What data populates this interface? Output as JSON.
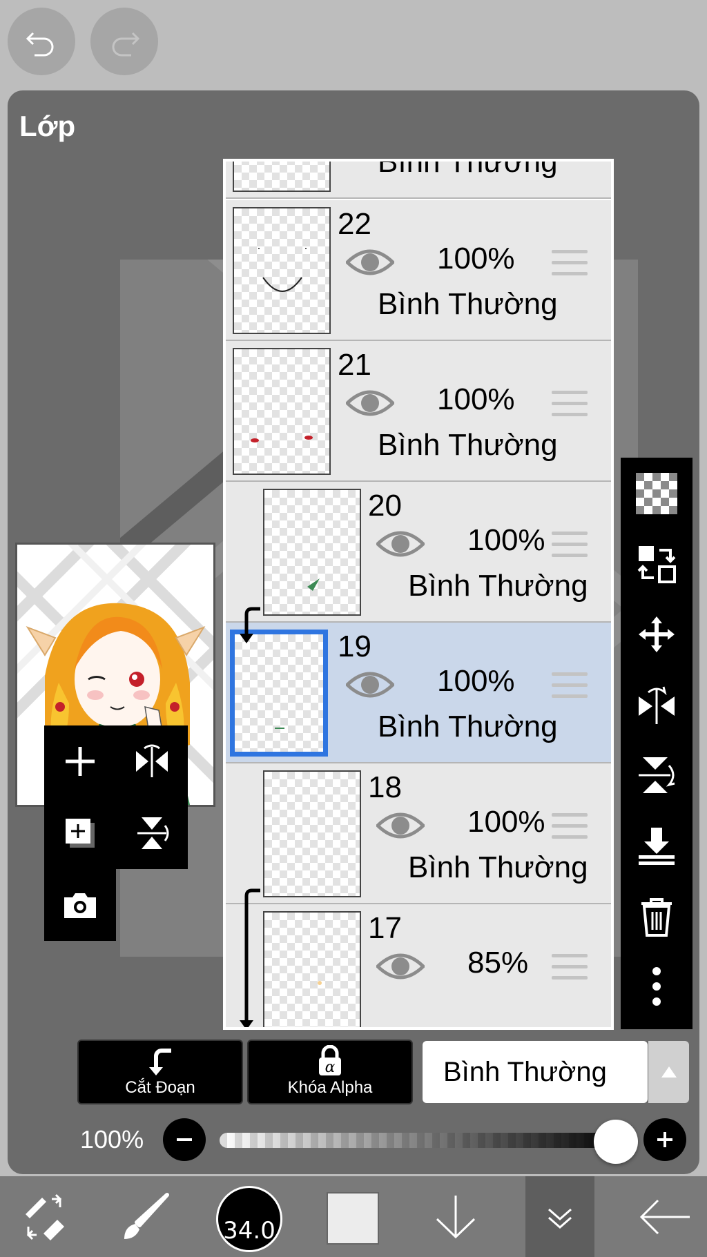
{
  "top_buttons": {
    "undo_icon": "undo-icon",
    "redo_icon": "redo-icon"
  },
  "panel": {
    "title": "Lớp"
  },
  "layers": [
    {
      "name": "",
      "opacity": "",
      "blend": "Bình Thường",
      "selected": false,
      "clipped": false
    },
    {
      "name": "22",
      "opacity": "100%",
      "blend": "Bình Thường",
      "selected": false,
      "clipped": false
    },
    {
      "name": "21",
      "opacity": "100%",
      "blend": "Bình Thường",
      "selected": false,
      "clipped": false
    },
    {
      "name": "20",
      "opacity": "100%",
      "blend": "Bình Thường",
      "selected": false,
      "clipped": true
    },
    {
      "name": "19",
      "opacity": "100%",
      "blend": "Bình Thường",
      "selected": true,
      "clipped": false
    },
    {
      "name": "18",
      "opacity": "100%",
      "blend": "Bình Thường",
      "selected": false,
      "clipped": true
    },
    {
      "name": "17",
      "opacity": "85%",
      "blend": "",
      "selected": false,
      "clipped": true
    }
  ],
  "left_tools": [
    "add-layer-icon",
    "flip-horizontal-icon",
    "add-copy-layer-icon",
    "flip-vertical-icon",
    "camera-icon"
  ],
  "right_tools": [
    "transparency-icon",
    "swap-layer-icon",
    "move-icon",
    "flip-horizontal-icon",
    "flip-vertical-icon",
    "merge-down-icon",
    "trash-icon",
    "more-icon"
  ],
  "bottom_actions": {
    "clip_label": "Cắt Đoạn",
    "alpha_lock_label": "Khóa Alpha"
  },
  "blend_mode": {
    "selected": "Bình Thường"
  },
  "opacity_slider": {
    "label": "100%",
    "value": 1.0
  },
  "toolbar": {
    "brush_size": "34.0",
    "color": "#ececec"
  },
  "colors": {
    "accent": "#2f75e0",
    "selected_row": "#cad7ea",
    "panel": "#6b6b6b"
  }
}
